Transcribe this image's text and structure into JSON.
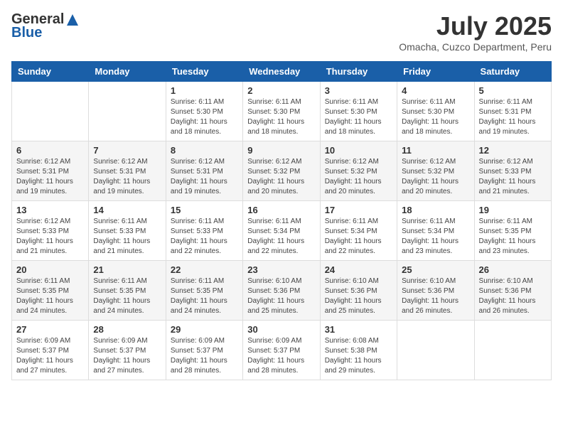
{
  "header": {
    "logo_general": "General",
    "logo_blue": "Blue",
    "month_title": "July 2025",
    "location": "Omacha, Cuzco Department, Peru"
  },
  "days_of_week": [
    "Sunday",
    "Monday",
    "Tuesday",
    "Wednesday",
    "Thursday",
    "Friday",
    "Saturday"
  ],
  "weeks": [
    [
      {
        "day": "",
        "sunrise": "",
        "sunset": "",
        "daylight": ""
      },
      {
        "day": "",
        "sunrise": "",
        "sunset": "",
        "daylight": ""
      },
      {
        "day": "1",
        "sunrise": "Sunrise: 6:11 AM",
        "sunset": "Sunset: 5:30 PM",
        "daylight": "Daylight: 11 hours and 18 minutes."
      },
      {
        "day": "2",
        "sunrise": "Sunrise: 6:11 AM",
        "sunset": "Sunset: 5:30 PM",
        "daylight": "Daylight: 11 hours and 18 minutes."
      },
      {
        "day": "3",
        "sunrise": "Sunrise: 6:11 AM",
        "sunset": "Sunset: 5:30 PM",
        "daylight": "Daylight: 11 hours and 18 minutes."
      },
      {
        "day": "4",
        "sunrise": "Sunrise: 6:11 AM",
        "sunset": "Sunset: 5:30 PM",
        "daylight": "Daylight: 11 hours and 18 minutes."
      },
      {
        "day": "5",
        "sunrise": "Sunrise: 6:11 AM",
        "sunset": "Sunset: 5:31 PM",
        "daylight": "Daylight: 11 hours and 19 minutes."
      }
    ],
    [
      {
        "day": "6",
        "sunrise": "Sunrise: 6:12 AM",
        "sunset": "Sunset: 5:31 PM",
        "daylight": "Daylight: 11 hours and 19 minutes."
      },
      {
        "day": "7",
        "sunrise": "Sunrise: 6:12 AM",
        "sunset": "Sunset: 5:31 PM",
        "daylight": "Daylight: 11 hours and 19 minutes."
      },
      {
        "day": "8",
        "sunrise": "Sunrise: 6:12 AM",
        "sunset": "Sunset: 5:31 PM",
        "daylight": "Daylight: 11 hours and 19 minutes."
      },
      {
        "day": "9",
        "sunrise": "Sunrise: 6:12 AM",
        "sunset": "Sunset: 5:32 PM",
        "daylight": "Daylight: 11 hours and 20 minutes."
      },
      {
        "day": "10",
        "sunrise": "Sunrise: 6:12 AM",
        "sunset": "Sunset: 5:32 PM",
        "daylight": "Daylight: 11 hours and 20 minutes."
      },
      {
        "day": "11",
        "sunrise": "Sunrise: 6:12 AM",
        "sunset": "Sunset: 5:32 PM",
        "daylight": "Daylight: 11 hours and 20 minutes."
      },
      {
        "day": "12",
        "sunrise": "Sunrise: 6:12 AM",
        "sunset": "Sunset: 5:33 PM",
        "daylight": "Daylight: 11 hours and 21 minutes."
      }
    ],
    [
      {
        "day": "13",
        "sunrise": "Sunrise: 6:12 AM",
        "sunset": "Sunset: 5:33 PM",
        "daylight": "Daylight: 11 hours and 21 minutes."
      },
      {
        "day": "14",
        "sunrise": "Sunrise: 6:11 AM",
        "sunset": "Sunset: 5:33 PM",
        "daylight": "Daylight: 11 hours and 21 minutes."
      },
      {
        "day": "15",
        "sunrise": "Sunrise: 6:11 AM",
        "sunset": "Sunset: 5:33 PM",
        "daylight": "Daylight: 11 hours and 22 minutes."
      },
      {
        "day": "16",
        "sunrise": "Sunrise: 6:11 AM",
        "sunset": "Sunset: 5:34 PM",
        "daylight": "Daylight: 11 hours and 22 minutes."
      },
      {
        "day": "17",
        "sunrise": "Sunrise: 6:11 AM",
        "sunset": "Sunset: 5:34 PM",
        "daylight": "Daylight: 11 hours and 22 minutes."
      },
      {
        "day": "18",
        "sunrise": "Sunrise: 6:11 AM",
        "sunset": "Sunset: 5:34 PM",
        "daylight": "Daylight: 11 hours and 23 minutes."
      },
      {
        "day": "19",
        "sunrise": "Sunrise: 6:11 AM",
        "sunset": "Sunset: 5:35 PM",
        "daylight": "Daylight: 11 hours and 23 minutes."
      }
    ],
    [
      {
        "day": "20",
        "sunrise": "Sunrise: 6:11 AM",
        "sunset": "Sunset: 5:35 PM",
        "daylight": "Daylight: 11 hours and 24 minutes."
      },
      {
        "day": "21",
        "sunrise": "Sunrise: 6:11 AM",
        "sunset": "Sunset: 5:35 PM",
        "daylight": "Daylight: 11 hours and 24 minutes."
      },
      {
        "day": "22",
        "sunrise": "Sunrise: 6:11 AM",
        "sunset": "Sunset: 5:35 PM",
        "daylight": "Daylight: 11 hours and 24 minutes."
      },
      {
        "day": "23",
        "sunrise": "Sunrise: 6:10 AM",
        "sunset": "Sunset: 5:36 PM",
        "daylight": "Daylight: 11 hours and 25 minutes."
      },
      {
        "day": "24",
        "sunrise": "Sunrise: 6:10 AM",
        "sunset": "Sunset: 5:36 PM",
        "daylight": "Daylight: 11 hours and 25 minutes."
      },
      {
        "day": "25",
        "sunrise": "Sunrise: 6:10 AM",
        "sunset": "Sunset: 5:36 PM",
        "daylight": "Daylight: 11 hours and 26 minutes."
      },
      {
        "day": "26",
        "sunrise": "Sunrise: 6:10 AM",
        "sunset": "Sunset: 5:36 PM",
        "daylight": "Daylight: 11 hours and 26 minutes."
      }
    ],
    [
      {
        "day": "27",
        "sunrise": "Sunrise: 6:09 AM",
        "sunset": "Sunset: 5:37 PM",
        "daylight": "Daylight: 11 hours and 27 minutes."
      },
      {
        "day": "28",
        "sunrise": "Sunrise: 6:09 AM",
        "sunset": "Sunset: 5:37 PM",
        "daylight": "Daylight: 11 hours and 27 minutes."
      },
      {
        "day": "29",
        "sunrise": "Sunrise: 6:09 AM",
        "sunset": "Sunset: 5:37 PM",
        "daylight": "Daylight: 11 hours and 28 minutes."
      },
      {
        "day": "30",
        "sunrise": "Sunrise: 6:09 AM",
        "sunset": "Sunset: 5:37 PM",
        "daylight": "Daylight: 11 hours and 28 minutes."
      },
      {
        "day": "31",
        "sunrise": "Sunrise: 6:08 AM",
        "sunset": "Sunset: 5:38 PM",
        "daylight": "Daylight: 11 hours and 29 minutes."
      },
      {
        "day": "",
        "sunrise": "",
        "sunset": "",
        "daylight": ""
      },
      {
        "day": "",
        "sunrise": "",
        "sunset": "",
        "daylight": ""
      }
    ]
  ]
}
